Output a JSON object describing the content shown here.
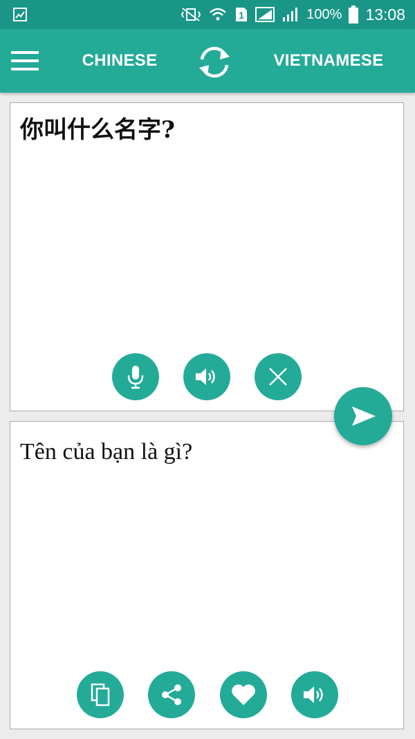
{
  "status_bar": {
    "battery_percent": "100%",
    "time": "13:08",
    "sim_slot": "1"
  },
  "app_bar": {
    "source_language": "CHINESE",
    "target_language": "VIETNAMESE"
  },
  "source_panel": {
    "text": "你叫什么名字?"
  },
  "target_panel": {
    "text": "Tên của bạn là gì?"
  },
  "colors": {
    "status_bar": "#1a9688",
    "app_bar": "#23ab98",
    "button": "#23ab98",
    "panel_border": "#a9a9a9",
    "background": "#ececec"
  },
  "icons": {
    "menu": "hamburger-icon",
    "swap": "swap-languages-icon",
    "mic": "microphone-icon",
    "speak_source": "speaker-icon",
    "clear": "close-icon",
    "translate": "send-icon",
    "copy": "copy-icon",
    "share": "share-icon",
    "favorite": "heart-icon",
    "speak_target": "speaker-icon"
  }
}
